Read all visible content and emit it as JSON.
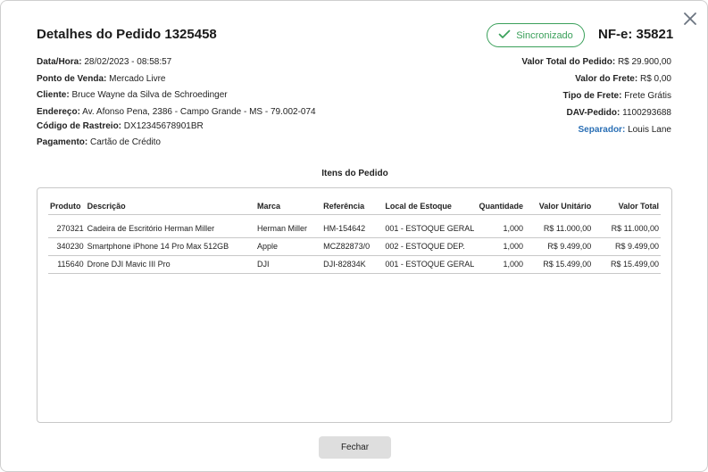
{
  "modal": {
    "title": "Detalhes do Pedido 1325458",
    "sync_badge": "Sincronizado",
    "nfe": "NF-e: 35821",
    "close_icon": "close-icon",
    "colors": {
      "accent_green": "#3aa05a",
      "link_blue": "#2a6fb5",
      "button_gray": "#dedede"
    }
  },
  "info_left": [
    {
      "label": "Data/Hora:",
      "value": "28/02/2023 - 08:58:57"
    },
    {
      "label": "Ponto de Venda:",
      "value": "Mercado Livre"
    },
    {
      "label": "Cliente:",
      "value": "Bruce Wayne da Silva de Schroedinger"
    },
    {
      "label": "Endereço:",
      "value": "Av. Afonso Pena, 2386 - Campo Grande - MS - 79.002-074"
    },
    {
      "label": "Código de Rastreio:",
      "value": "DX12345678901BR"
    },
    {
      "label": "Pagamento:",
      "value": "Cartão de Crédito"
    }
  ],
  "info_right": [
    {
      "label": "Valor Total do Pedido:",
      "value": "R$ 29.900,00"
    },
    {
      "label": "Valor do Frete:",
      "value": "R$ 0,00"
    },
    {
      "label": "Tipo de Frete:",
      "value": "Frete Grátis"
    },
    {
      "label": "DAV-Pedido:",
      "value": "1100293688"
    },
    {
      "label": "Separador:",
      "value": "Louis Lane"
    }
  ],
  "items_title": "Itens do Pedido",
  "table": {
    "headers": [
      "Produto",
      "Descrição",
      "Marca",
      "Referência",
      "Local de Estoque",
      "Quantidade",
      "Valor Unitário",
      "Valor Total"
    ],
    "rows": [
      [
        "270321",
        "Cadeira de Escritório Herman Miller",
        "Herman Miller",
        "HM-154642",
        "001 - ESTOQUE GERAL",
        "1,000",
        "R$ 11.000,00",
        "R$ 11.000,00"
      ],
      [
        "340230",
        "Smartphone iPhone 14 Pro Max 512GB",
        "Apple",
        "MCZ82873/0",
        "002 - ESTOQUE DEP.",
        "1,000",
        "R$ 9.499,00",
        "R$ 9.499,00"
      ],
      [
        "115640",
        "Drone DJI Mavic III Pro",
        "DJI",
        "DJI-82834K",
        "001 - ESTOQUE GERAL",
        "1,000",
        "R$ 15.499,00",
        "R$ 15.499,00"
      ]
    ]
  },
  "footer": {
    "close_label": "Fechar"
  }
}
